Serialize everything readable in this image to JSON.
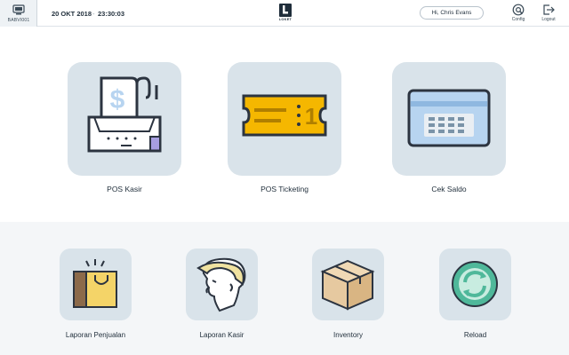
{
  "header": {
    "device_id": "BABVI001",
    "date": "20 OKT 2018",
    "separator": "-",
    "time": "23:30:03",
    "logo_text": "LOKET",
    "greeting": "Hi, Chris Evans",
    "config_label": "Config",
    "logout_label": "Logout"
  },
  "main_menu": [
    {
      "label": "POS Kasir",
      "icon": "cash-register-icon"
    },
    {
      "label": "POS Ticketing",
      "icon": "ticket-icon"
    },
    {
      "label": "Cek Saldo",
      "icon": "card-balance-icon"
    }
  ],
  "secondary_menu": [
    {
      "label": "Laporan Penjualan",
      "icon": "shopping-bag-icon"
    },
    {
      "label": "Laporan Kasir",
      "icon": "cashier-face-icon"
    },
    {
      "label": "Inventory",
      "icon": "box-icon"
    },
    {
      "label": "Reload",
      "icon": "reload-icon"
    }
  ],
  "colors": {
    "tile_bg": "#d9e3ea",
    "ticket_yellow": "#f5b700",
    "card_blue": "#b7d4f0",
    "bag_yellow": "#f4d468",
    "reload_green": "#4fb89a",
    "box_tan": "#e6c9a0",
    "outline": "#2c3440"
  }
}
